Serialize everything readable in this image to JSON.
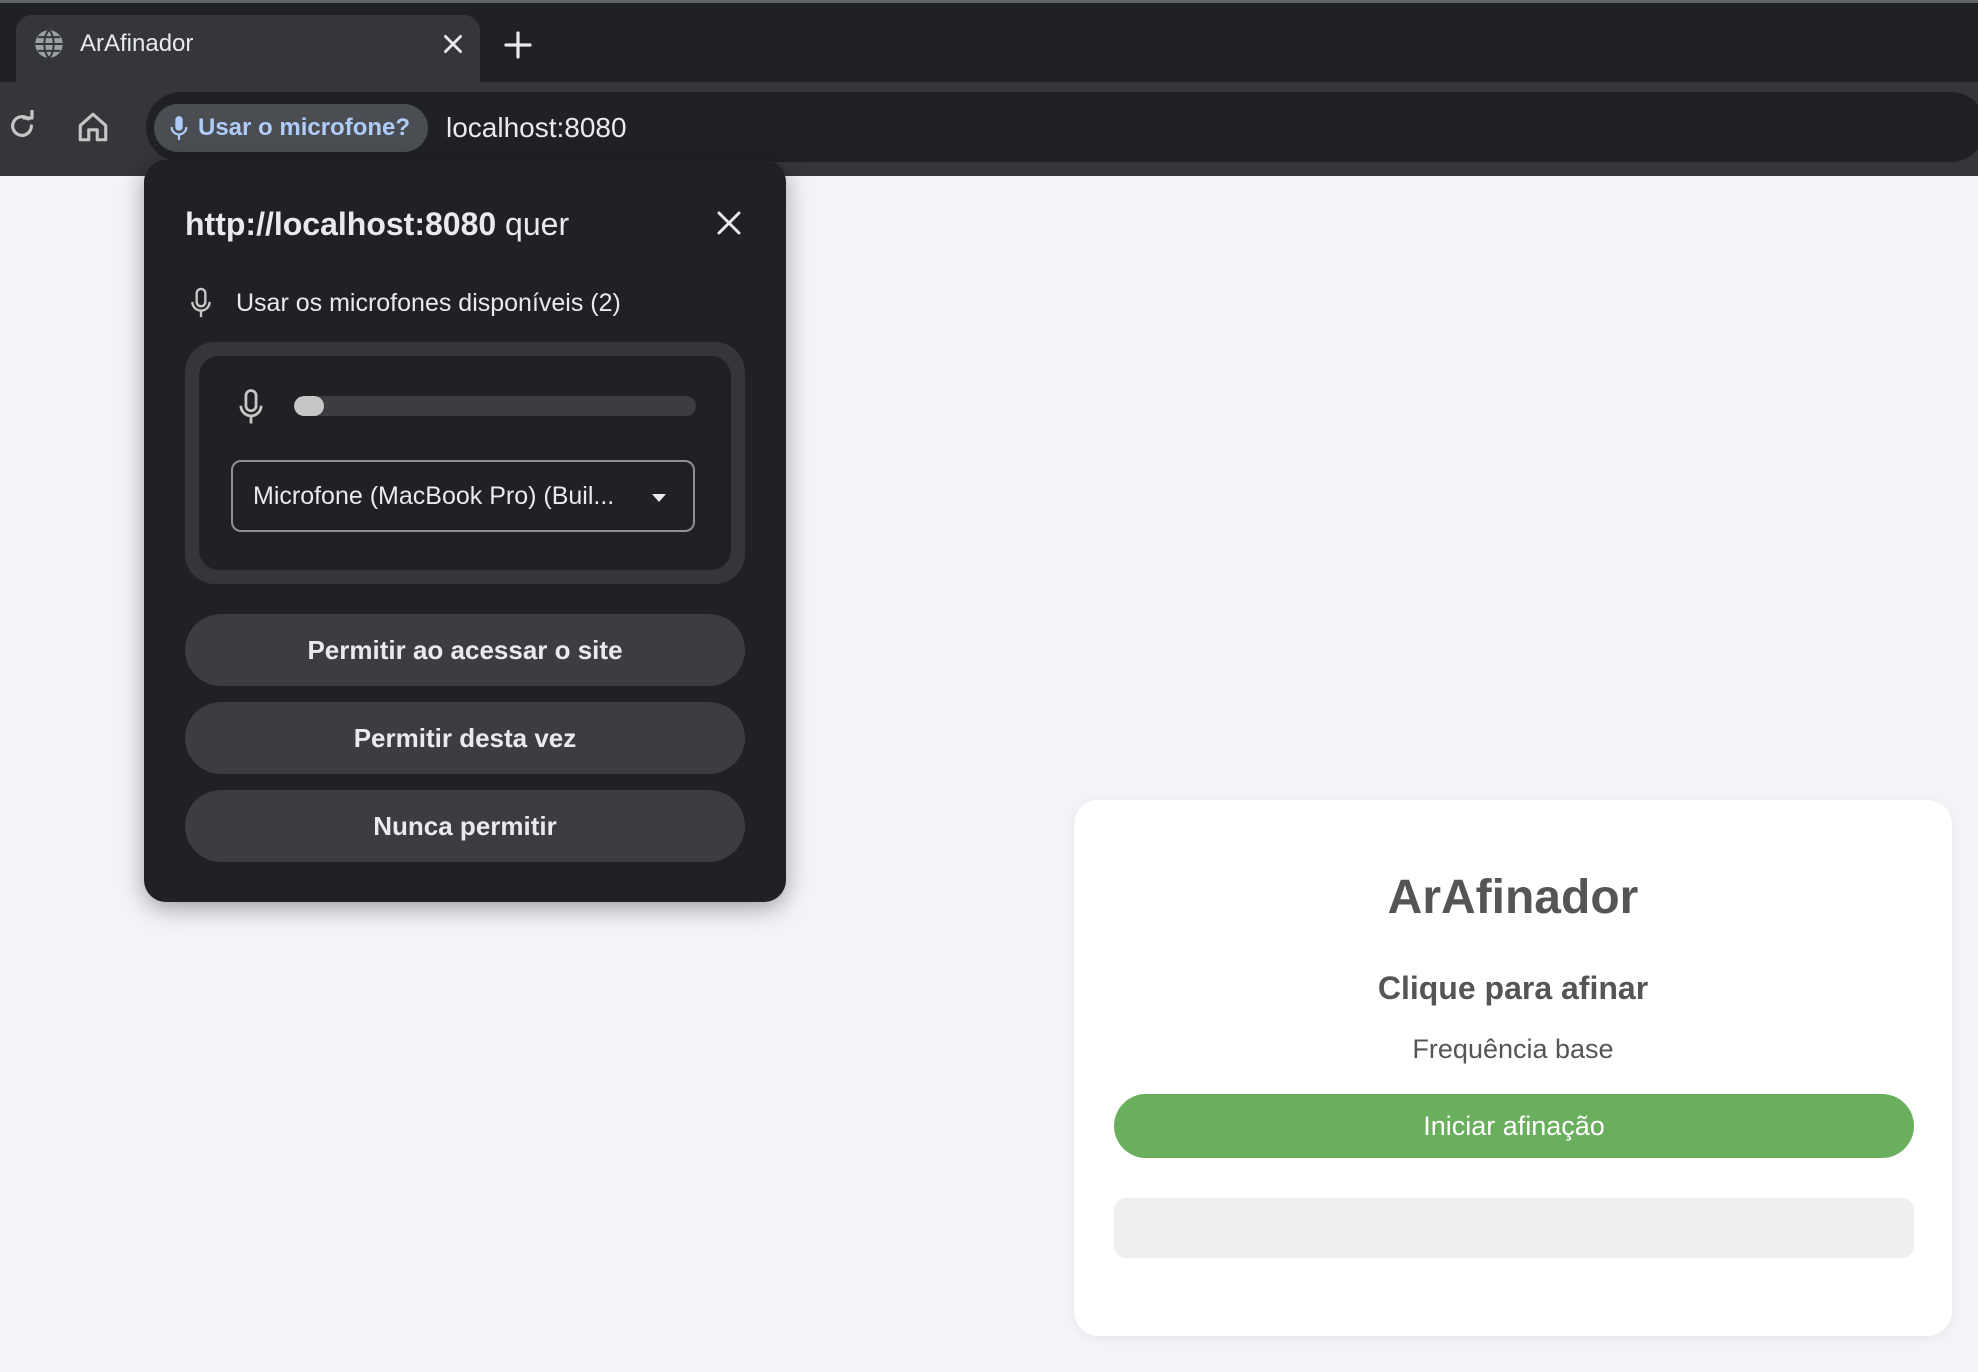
{
  "browser": {
    "tab": {
      "title": "ArAfinador",
      "favicon": "globe-icon"
    },
    "toolbar": {
      "reload_icon": "reload-icon",
      "home_icon": "home-icon",
      "mic_chip_label": "Usar o microfone?",
      "url": "localhost:8080"
    }
  },
  "permission_popup": {
    "title_origin": "http://localhost:8080",
    "title_suffix": " quer",
    "permission_label": "Usar os microfones disponíveis (2)",
    "mic_level": 0.04,
    "selected_device": "Microfone (MacBook Pro) (Buil...",
    "buttons": {
      "allow_on_visit": "Permitir ao acessar o site",
      "allow_this_time": "Permitir desta vez",
      "never_allow": "Nunca permitir"
    }
  },
  "page": {
    "title": "ArAfinador",
    "subtitle": "Clique para afinar",
    "frequency_label": "Frequência base",
    "start_button": "Iniciar afinação",
    "result_text": ""
  },
  "colors": {
    "chrome_dark": "#202124",
    "chrome_toolbar": "#35363a",
    "chip_text": "#aecbfa",
    "accent_green": "#6aaf5e",
    "page_bg": "#f4f3f8"
  }
}
